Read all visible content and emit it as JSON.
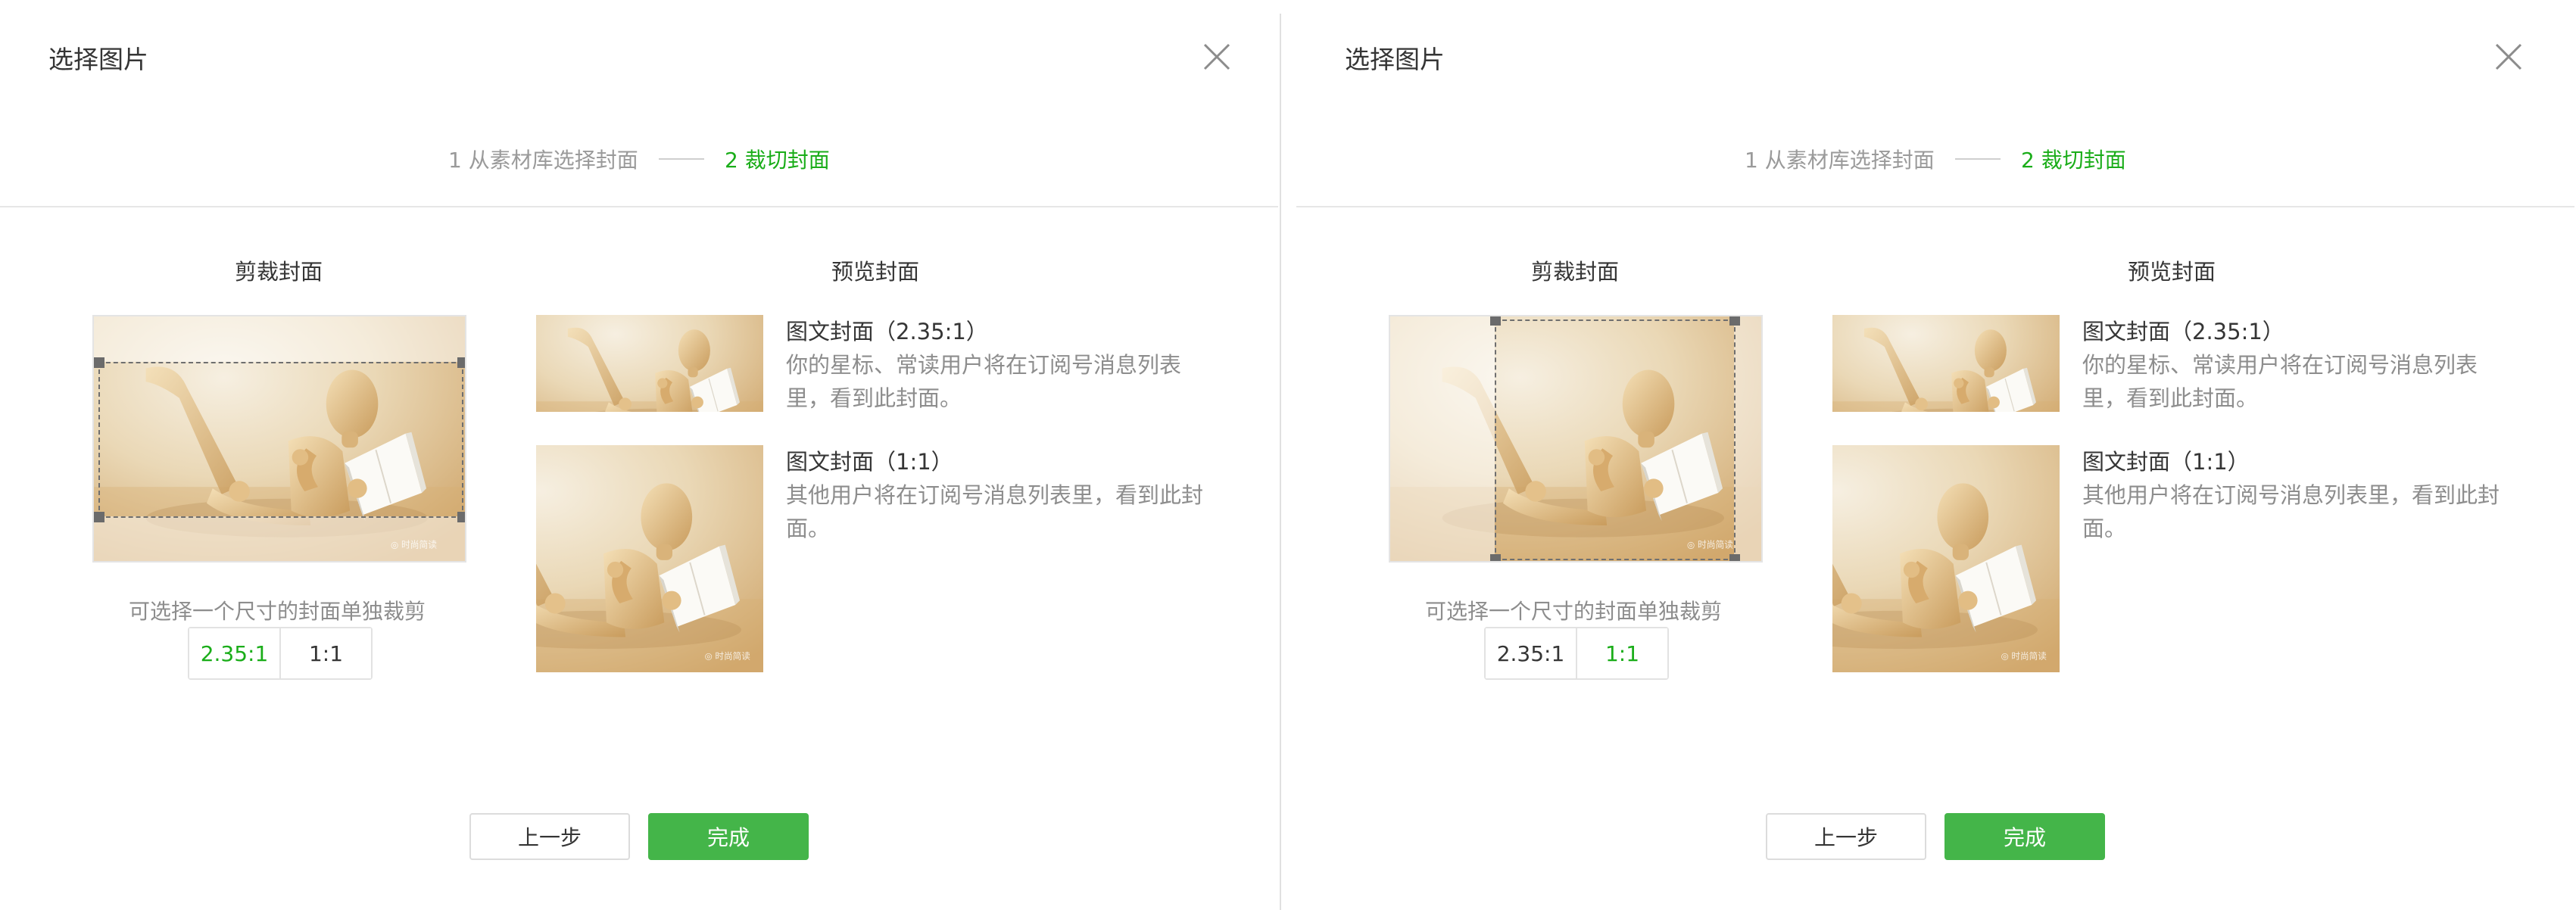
{
  "colors": {
    "accent": "#1aad19",
    "primary_button": "#44b549",
    "muted_text": "#8d8d8d",
    "text": "#353535"
  },
  "dialogs": [
    {
      "title": "选择图片",
      "close_icon": "close-icon",
      "steps": {
        "step1": "1 从素材库选择封面",
        "step2": "2 裁切封面",
        "active_step": 2
      },
      "crop": {
        "title": "剪裁封面",
        "hint": "可选择一个尺寸的封面单独裁剪",
        "ratios": [
          "2.35:1",
          "1:1"
        ],
        "selected_ratio": "2.35:1"
      },
      "preview": {
        "title": "预览封面",
        "items": [
          {
            "title": "图文封面（2.35:1）",
            "desc": "你的星标、常读用户将在订阅号消息列表里，看到此封面。"
          },
          {
            "title": "图文封面（1:1）",
            "desc": "其他用户将在订阅号消息列表里，看到此封面。"
          }
        ]
      },
      "buttons": {
        "prev": "上一步",
        "done": "完成"
      }
    },
    {
      "title": "选择图片",
      "close_icon": "close-icon",
      "steps": {
        "step1": "1 从素材库选择封面",
        "step2": "2 裁切封面",
        "active_step": 2
      },
      "crop": {
        "title": "剪裁封面",
        "hint": "可选择一个尺寸的封面单独裁剪",
        "ratios": [
          "2.35:1",
          "1:1"
        ],
        "selected_ratio": "1:1"
      },
      "preview": {
        "title": "预览封面",
        "items": [
          {
            "title": "图文封面（2.35:1）",
            "desc": "你的星标、常读用户将在订阅号消息列表里，看到此封面。"
          },
          {
            "title": "图文封面（1:1）",
            "desc": "其他用户将在订阅号消息列表里，看到此封面。"
          }
        ]
      },
      "buttons": {
        "prev": "上一步",
        "done": "完成"
      }
    }
  ]
}
